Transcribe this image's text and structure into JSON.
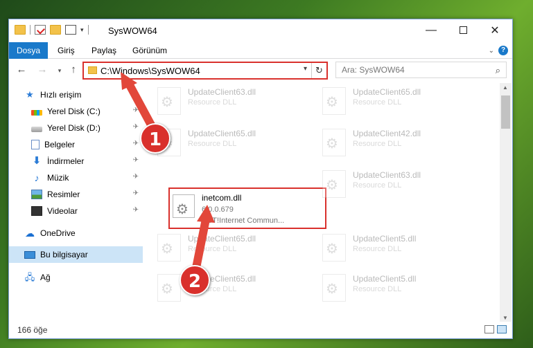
{
  "window": {
    "title": "SysWOW64"
  },
  "ribbon": {
    "tabs": [
      "Dosya",
      "Giriş",
      "Paylaş",
      "Görünüm"
    ]
  },
  "address": {
    "path": "C:\\Windows\\SysWOW64"
  },
  "search": {
    "placeholder": "Ara: SysWOW64"
  },
  "sidebar": {
    "items": [
      {
        "label": "Hızlı erişim",
        "icon": "star-icon"
      },
      {
        "label": "Yerel Disk (C:)",
        "icon": "disk-icon"
      },
      {
        "label": "Yerel Disk (D:)",
        "icon": "disk-icon"
      },
      {
        "label": "Belgeler",
        "icon": "document-icon"
      },
      {
        "label": "İndirmeler",
        "icon": "download-icon"
      },
      {
        "label": "Müzik",
        "icon": "music-icon"
      },
      {
        "label": "Resimler",
        "icon": "pictures-icon"
      },
      {
        "label": "Videolar",
        "icon": "video-icon"
      },
      {
        "label": "OneDrive",
        "icon": "cloud-icon"
      },
      {
        "label": "Bu bilgisayar",
        "icon": "computer-icon"
      },
      {
        "label": "Ağ",
        "icon": "network-icon"
      }
    ]
  },
  "files": {
    "selected": {
      "name": "inetcom.dll",
      "version": "6.0.0.679",
      "description": "ACT!Internet Commun..."
    },
    "faded": [
      {
        "name": "UpdateClient63.dll",
        "type": "Resource DLL"
      },
      {
        "name": "UpdateClient65.dll",
        "type": "Resource DLL"
      },
      {
        "name": "UpdateClient65.dll",
        "type": "Resource DLL"
      },
      {
        "name": "UpdateClient42.dll",
        "type": "Resource DLL"
      },
      {
        "name": "UpdateClient63.dll",
        "type": "Resource DLL"
      },
      {
        "name": "UpdateClient65.dll",
        "type": "Resource DLL"
      },
      {
        "name": "UpdateClient5.dll",
        "type": "Resource DLL"
      },
      {
        "name": "UpdateClient65.dll",
        "type": "Resource DLL"
      },
      {
        "name": "UpdateClient5.dll",
        "type": "Resource DLL"
      }
    ]
  },
  "status": {
    "count": "166 öğe"
  },
  "annotations": {
    "badge1": "1",
    "badge2": "2"
  },
  "colors": {
    "accent": "#1979ca",
    "highlight": "#d9302c"
  }
}
